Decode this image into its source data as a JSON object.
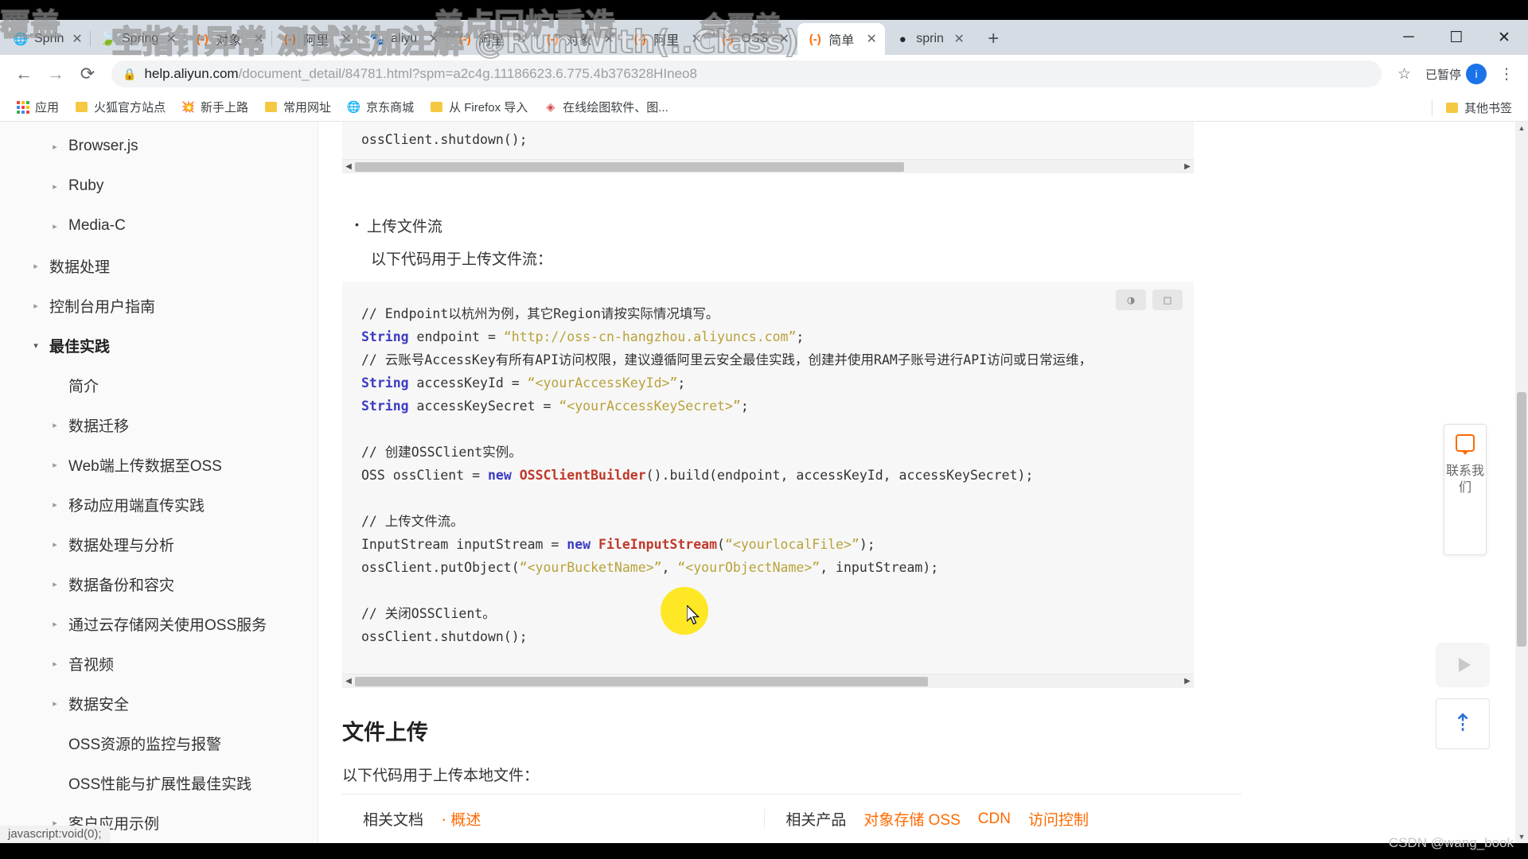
{
  "window": {
    "controls": {
      "minimize": "─",
      "maximize": "☐",
      "close": "✕"
    }
  },
  "tabs": [
    {
      "label": "Sprin",
      "icon": "globe-icon",
      "icon_kind": "globe",
      "active": false
    },
    {
      "label": "Spring",
      "icon": "globe-icon",
      "icon_kind": "leaf",
      "active": false
    },
    {
      "label": "对象",
      "icon": "oss-icon",
      "icon_kind": "oss",
      "active": false
    },
    {
      "label": "阿里",
      "icon": "oss-icon",
      "icon_kind": "oss",
      "active": false
    },
    {
      "label": "aliyu",
      "icon": "baidu-icon",
      "icon_kind": "baidu",
      "active": false
    },
    {
      "label": "阿里",
      "icon": "oss-icon",
      "icon_kind": "oss",
      "active": false
    },
    {
      "label": "对象",
      "icon": "oss-icon",
      "icon_kind": "oss",
      "active": false
    },
    {
      "label": "阿里",
      "icon": "oss-icon",
      "icon_kind": "oss",
      "active": false
    },
    {
      "label": "OSS",
      "icon": "oss-icon",
      "icon_kind": "oss",
      "active": false
    },
    {
      "label": "简单",
      "icon": "oss-icon",
      "icon_kind": "oss",
      "active": true
    },
    {
      "label": "sprin",
      "icon": "github-icon",
      "icon_kind": "github",
      "active": false
    }
  ],
  "tab_close_glyph": "✕",
  "new_tab_label": "+",
  "toolbar": {
    "back": "←",
    "forward": "→",
    "reload": "⟳",
    "lock_icon": "🔒",
    "url_host": "help.aliyun.com",
    "url_path": "/document_detail/84781.html?spm=a2c4g.11186623.6.775.4b376328HIneo8",
    "star": "☆",
    "paused_label": "已暂停",
    "avatar_initial": "i",
    "menu": "⋮"
  },
  "bookmarks": {
    "apps_label": "应用",
    "items": [
      {
        "label": "火狐官方站点",
        "icon": "folder-icon"
      },
      {
        "label": "新手上路",
        "icon": "firefox-icon"
      },
      {
        "label": "常用网址",
        "icon": "folder-icon"
      },
      {
        "label": "京东商城",
        "icon": "globe-icon"
      },
      {
        "label": "从 Firefox 导入",
        "icon": "folder-icon"
      },
      {
        "label": "在线绘图软件、图...",
        "icon": "diagram-icon"
      }
    ],
    "other_label": "其他书签",
    "other_icon": "folder-icon"
  },
  "sidebar": {
    "items": [
      {
        "label": "Browser.js",
        "level": 2,
        "arrow": "▸",
        "expanded": false,
        "bold": false
      },
      {
        "label": "Ruby",
        "level": 2,
        "arrow": "▸",
        "expanded": false,
        "bold": false
      },
      {
        "label": "Media-C",
        "level": 2,
        "arrow": "▸",
        "expanded": false,
        "bold": false
      },
      {
        "label": "数据处理",
        "level": 1,
        "arrow": "▸",
        "expanded": false,
        "bold": false
      },
      {
        "label": "控制台用户指南",
        "level": 1,
        "arrow": "▸",
        "expanded": false,
        "bold": false
      },
      {
        "label": "最佳实践",
        "level": 1,
        "arrow": "▾",
        "expanded": true,
        "bold": true
      },
      {
        "label": "简介",
        "level": 3,
        "arrow": "",
        "expanded": false,
        "bold": false
      },
      {
        "label": "数据迁移",
        "level": 2,
        "arrow": "▸",
        "expanded": false,
        "bold": false
      },
      {
        "label": "Web端上传数据至OSS",
        "level": 2,
        "arrow": "▸",
        "expanded": false,
        "bold": false
      },
      {
        "label": "移动应用端直传实践",
        "level": 2,
        "arrow": "▸",
        "expanded": false,
        "bold": false
      },
      {
        "label": "数据处理与分析",
        "level": 2,
        "arrow": "▸",
        "expanded": false,
        "bold": false
      },
      {
        "label": "数据备份和容灾",
        "level": 2,
        "arrow": "▸",
        "expanded": false,
        "bold": false
      },
      {
        "label": "通过云存储网关使用OSS服务",
        "level": 2,
        "arrow": "▸",
        "expanded": false,
        "bold": false
      },
      {
        "label": "音视频",
        "level": 2,
        "arrow": "▸",
        "expanded": false,
        "bold": false
      },
      {
        "label": "数据安全",
        "level": 2,
        "arrow": "▸",
        "expanded": false,
        "bold": false
      },
      {
        "label": "OSS资源的监控与报警",
        "level": 3,
        "arrow": "",
        "expanded": false,
        "bold": false
      },
      {
        "label": "OSS性能与扩展性最佳实践",
        "level": 3,
        "arrow": "",
        "expanded": false,
        "bold": false
      },
      {
        "label": "客户应用示例",
        "level": 2,
        "arrow": "▸",
        "expanded": false,
        "bold": false
      }
    ],
    "status_link": "javascript:void(0);"
  },
  "content": {
    "top_code_tail": "ossClient.shutdown();",
    "bullet_title": "上传文件流",
    "bullet_desc": "以下代码用于上传文件流：",
    "code_tools": {
      "theme": "◑",
      "copy": "□"
    },
    "code_lines": [
      {
        "type": "comment",
        "text": "// Endpoint以杭州为例，其它Region请按实际情况填写。"
      },
      {
        "type": "decl",
        "kw": "String",
        "mid": " endpoint = ",
        "str": "“http://oss-cn-hangzhou.aliyuncs.com”",
        "tail": ";"
      },
      {
        "type": "comment",
        "text": "// 云账号AccessKey有所有API访问权限，建议遵循阿里云安全最佳实践，创建并使用RAM子账号进行API访问或日常运维，"
      },
      {
        "type": "decl",
        "kw": "String",
        "mid": " accessKeyId = ",
        "str": "“<yourAccessKeyId>”",
        "tail": ";"
      },
      {
        "type": "decl",
        "kw": "String",
        "mid": " accessKeySecret = ",
        "str": "“<yourAccessKeySecret>”",
        "tail": ";"
      },
      {
        "type": "blank",
        "text": ""
      },
      {
        "type": "comment",
        "text": "// 创建OSSClient实例。"
      },
      {
        "type": "ossline",
        "pre": "OSS ossClient = ",
        "kw": "new",
        "cls": " OSSClientBuilder",
        "tail": "().build(endpoint, accessKeyId, accessKeySecret);"
      },
      {
        "type": "blank",
        "text": ""
      },
      {
        "type": "comment",
        "text": "// 上传文件流。"
      },
      {
        "type": "isline",
        "pre": "InputStream inputStream = ",
        "kw": "new",
        "cls": " FileInputStream",
        "open": "(",
        "str": "“<yourlocalFile>”",
        "tail": ");"
      },
      {
        "type": "putline",
        "pre": "ossClient.putObject(",
        "str1": "“<yourBucketName>”",
        "mid": ", ",
        "str2": "“<yourObjectName>”",
        "tail": ", inputStream);"
      },
      {
        "type": "blank",
        "text": ""
      },
      {
        "type": "comment",
        "text": "// 关闭OSSClient。"
      },
      {
        "type": "plain",
        "text": "ossClient.shutdown();"
      }
    ],
    "heading": "文件上传",
    "heading_desc": "以下代码用于上传本地文件："
  },
  "related": {
    "docs_label": "相关文档",
    "docs_links": [
      "概述"
    ],
    "products_label": "相关产品",
    "product_links": [
      "对象存储 OSS",
      "CDN",
      "访问控制"
    ]
  },
  "widgets": {
    "contact_icon": "chat-bubble-icon",
    "contact_text": "联系我们",
    "play_icon": "play-icon",
    "back_to_top_icon": "chevron-up-icon"
  },
  "overlay": {
    "main": "空指针异常  测试类加注解  @RunWith(..Class)",
    "top_left": "覆盖",
    "top_mid": "差点回炉重造",
    "top_right": "会覆盖"
  },
  "watermark": "CSDN @wang_book",
  "colors": {
    "accent_orange": "#ff6a00",
    "tabstrip_bg": "#d6dce3",
    "code_bg": "#f7f7f7",
    "highlight_yellow": "#ffe400"
  }
}
